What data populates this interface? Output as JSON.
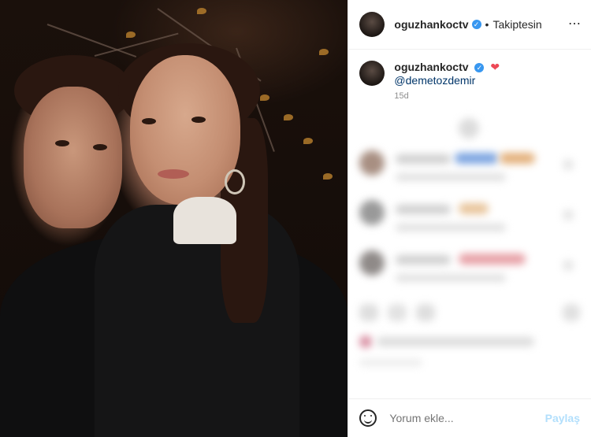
{
  "header": {
    "username": "oguzhankoctv",
    "separator": "•",
    "follow_status": "Takiptesin",
    "more_label": "⋯"
  },
  "caption": {
    "username": "oguzhankoctv",
    "heart": "❤",
    "mention": "@demetozdemir",
    "time": "15d"
  },
  "footer": {
    "placeholder": "Yorum ekle...",
    "share_label": "Paylaş"
  },
  "colors": {
    "verified": "#3897f0",
    "heart": "#ed4956",
    "mention": "#003569",
    "share": "#b2dffc"
  },
  "icons": {
    "verified": "verified-badge-icon",
    "emoji": "emoji-icon",
    "more": "more-options-icon"
  }
}
